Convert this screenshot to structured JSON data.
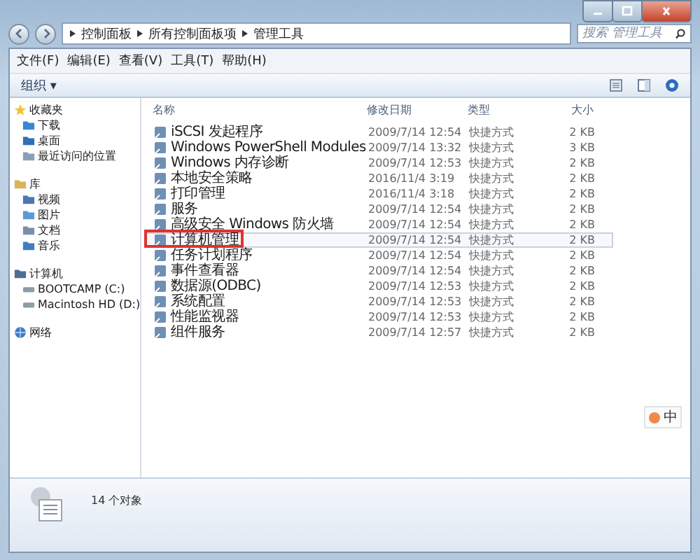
{
  "address_bar": {
    "path": [
      "控制面板",
      "所有控制面板项",
      "管理工具"
    ],
    "search_placeholder": "搜索 管理工具"
  },
  "menu": [
    "文件(F)",
    "编辑(E)",
    "查看(V)",
    "工具(T)",
    "帮助(H)"
  ],
  "toolbar": {
    "organize": "组织 ▾"
  },
  "sidebar": {
    "groups": [
      {
        "label": "收藏夹",
        "children": [
          {
            "label": "下载"
          },
          {
            "label": "桌面"
          },
          {
            "label": "最近访问的位置"
          }
        ]
      },
      {
        "label": "库",
        "children": [
          {
            "label": "视频"
          },
          {
            "label": "图片"
          },
          {
            "label": "文档"
          },
          {
            "label": "音乐"
          }
        ]
      },
      {
        "label": "计算机",
        "children": [
          {
            "label": "BOOTCAMP (C:)"
          },
          {
            "label": "Macintosh HD (D:)"
          }
        ]
      },
      {
        "label": "网络"
      }
    ]
  },
  "table": {
    "columns": [
      "名称",
      "修改日期",
      "类型",
      "大小"
    ],
    "rows": [
      {
        "name": "iSCSI 发起程序",
        "date": "2009/7/14 12:54",
        "type": "快捷方式",
        "size": "2 KB",
        "selected": false,
        "annotated": false
      },
      {
        "name": "Windows PowerShell Modules",
        "date": "2009/7/14 13:32",
        "type": "快捷方式",
        "size": "3 KB",
        "selected": false,
        "annotated": false
      },
      {
        "name": "Windows 内存诊断",
        "date": "2009/7/14 12:53",
        "type": "快捷方式",
        "size": "2 KB",
        "selected": false,
        "annotated": false
      },
      {
        "name": "本地安全策略",
        "date": "2016/11/4 3:19",
        "type": "快捷方式",
        "size": "2 KB",
        "selected": false,
        "annotated": false
      },
      {
        "name": "打印管理",
        "date": "2016/11/4 3:18",
        "type": "快捷方式",
        "size": "2 KB",
        "selected": false,
        "annotated": false
      },
      {
        "name": "服务",
        "date": "2009/7/14 12:54",
        "type": "快捷方式",
        "size": "2 KB",
        "selected": false,
        "annotated": false
      },
      {
        "name": "高级安全 Windows 防火墙",
        "date": "2009/7/14 12:54",
        "type": "快捷方式",
        "size": "2 KB",
        "selected": false,
        "annotated": false
      },
      {
        "name": "计算机管理",
        "date": "2009/7/14 12:54",
        "type": "快捷方式",
        "size": "2 KB",
        "selected": true,
        "annotated": true
      },
      {
        "name": "任务计划程序",
        "date": "2009/7/14 12:54",
        "type": "快捷方式",
        "size": "2 KB",
        "selected": false,
        "annotated": false
      },
      {
        "name": "事件查看器",
        "date": "2009/7/14 12:54",
        "type": "快捷方式",
        "size": "2 KB",
        "selected": false,
        "annotated": false
      },
      {
        "name": "数据源(ODBC)",
        "date": "2009/7/14 12:53",
        "type": "快捷方式",
        "size": "2 KB",
        "selected": false,
        "annotated": false
      },
      {
        "name": "系统配置",
        "date": "2009/7/14 12:53",
        "type": "快捷方式",
        "size": "2 KB",
        "selected": false,
        "annotated": false
      },
      {
        "name": "性能监视器",
        "date": "2009/7/14 12:53",
        "type": "快捷方式",
        "size": "2 KB",
        "selected": false,
        "annotated": false
      },
      {
        "name": "组件服务",
        "date": "2009/7/14 12:57",
        "type": "快捷方式",
        "size": "2 KB",
        "selected": false,
        "annotated": false
      }
    ]
  },
  "ime_indicator": "中",
  "status_bar": {
    "count": "14 个对象"
  }
}
